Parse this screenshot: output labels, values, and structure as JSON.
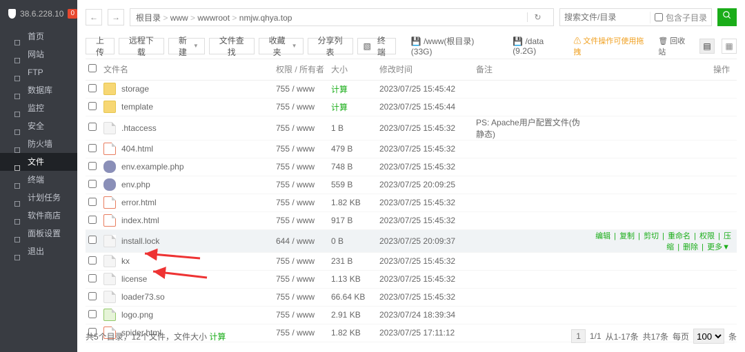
{
  "host_ip": "38.6.228.10",
  "host_badge": "0",
  "sidebar": [
    {
      "label": "首页",
      "active": false
    },
    {
      "label": "网站",
      "active": false
    },
    {
      "label": "FTP",
      "active": false
    },
    {
      "label": "数据库",
      "active": false
    },
    {
      "label": "监控",
      "active": false
    },
    {
      "label": "安全",
      "active": false
    },
    {
      "label": "防火墙",
      "active": false
    },
    {
      "label": "文件",
      "active": true
    },
    {
      "label": "终端",
      "active": false
    },
    {
      "label": "计划任务",
      "active": false
    },
    {
      "label": "软件商店",
      "active": false
    },
    {
      "label": "面板设置",
      "active": false
    },
    {
      "label": "退出",
      "active": false
    }
  ],
  "breadcrumb": [
    "根目录",
    "www",
    "wwwroot",
    "nmjw.qhya.top"
  ],
  "search": {
    "placeholder": "搜索文件/目录",
    "include_sub": "包含子目录"
  },
  "toolbar": {
    "upload": "上传",
    "remote": "远程下载",
    "new": "新建",
    "find": "文件查找",
    "fav": "收藏夹",
    "share": "分享列表",
    "term": "终端",
    "disk1": "/www(根目录) (33G)",
    "disk2": "/data (9.2G)",
    "warn": "文件操作可使用拖拽",
    "trash": "回收站"
  },
  "columns": {
    "name": "文件名",
    "perm": "权限 / 所有者",
    "size": "大小",
    "mtime": "修改时间",
    "remark": "备注",
    "ops": "操作"
  },
  "rows": [
    {
      "icon": "folder",
      "name": "storage",
      "perm": "755 / www",
      "size_calc": true,
      "mtime": "2023/07/25 15:45:42",
      "remark": "",
      "sel": false
    },
    {
      "icon": "folder",
      "name": "template",
      "perm": "755 / www",
      "size_calc": true,
      "mtime": "2023/07/25 15:45:44",
      "remark": "",
      "sel": false
    },
    {
      "icon": "file",
      "name": ".htaccess",
      "perm": "755 / www",
      "size": "1 B",
      "mtime": "2023/07/25 15:45:32",
      "remark": "PS: Apache用户配置文件(伪静态)",
      "sel": false
    },
    {
      "icon": "html",
      "name": "404.html",
      "perm": "755 / www",
      "size": "479 B",
      "mtime": "2023/07/25 15:45:32",
      "remark": "",
      "sel": false
    },
    {
      "icon": "php",
      "name": "env.example.php",
      "perm": "755 / www",
      "size": "748 B",
      "mtime": "2023/07/25 15:45:32",
      "remark": "",
      "sel": false
    },
    {
      "icon": "php",
      "name": "env.php",
      "perm": "755 / www",
      "size": "559 B",
      "mtime": "2023/07/25 20:09:25",
      "remark": "",
      "sel": false
    },
    {
      "icon": "html",
      "name": "error.html",
      "perm": "755 / www",
      "size": "1.82 KB",
      "mtime": "2023/07/25 15:45:32",
      "remark": "",
      "sel": false
    },
    {
      "icon": "html",
      "name": "index.html",
      "perm": "755 / www",
      "size": "917 B",
      "mtime": "2023/07/25 15:45:32",
      "remark": "",
      "sel": false
    },
    {
      "icon": "file",
      "name": "install.lock",
      "perm": "644 / www",
      "size": "0 B",
      "mtime": "2023/07/25 20:09:37",
      "remark": "",
      "sel": true
    },
    {
      "icon": "file",
      "name": "kx",
      "perm": "755 / www",
      "size": "231 B",
      "mtime": "2023/07/25 15:45:32",
      "remark": "",
      "sel": false
    },
    {
      "icon": "file",
      "name": "license",
      "perm": "755 / www",
      "size": "1.13 KB",
      "mtime": "2023/07/25 15:45:32",
      "remark": "",
      "sel": false
    },
    {
      "icon": "file",
      "name": "loader73.so",
      "perm": "755 / www",
      "size": "66.64 KB",
      "mtime": "2023/07/25 15:45:32",
      "remark": "",
      "sel": false
    },
    {
      "icon": "png",
      "name": "logo.png",
      "perm": "755 / www",
      "size": "2.91 KB",
      "mtime": "2023/07/24 18:39:34",
      "remark": "",
      "sel": false
    },
    {
      "icon": "html",
      "name": "spider.html",
      "perm": "755 / www",
      "size": "1.82 KB",
      "mtime": "2023/07/25 17:11:12",
      "remark": "",
      "sel": false
    }
  ],
  "size_calc_label": "计算",
  "row_actions": {
    "edit": "编辑",
    "copy": "复制",
    "cut": "剪切",
    "rename": "重命名",
    "perm": "权限",
    "zip": "压缩",
    "del": "删除",
    "more": "更多"
  },
  "footer": {
    "summary_prefix": "共5个目录，12个文件，文件大小",
    "calc": "计算",
    "page": "1",
    "pages": "1/1",
    "range": "从1-17条",
    "total": "共17条",
    "per_prefix": "每页",
    "per": "100",
    "per_suffix": "条"
  }
}
